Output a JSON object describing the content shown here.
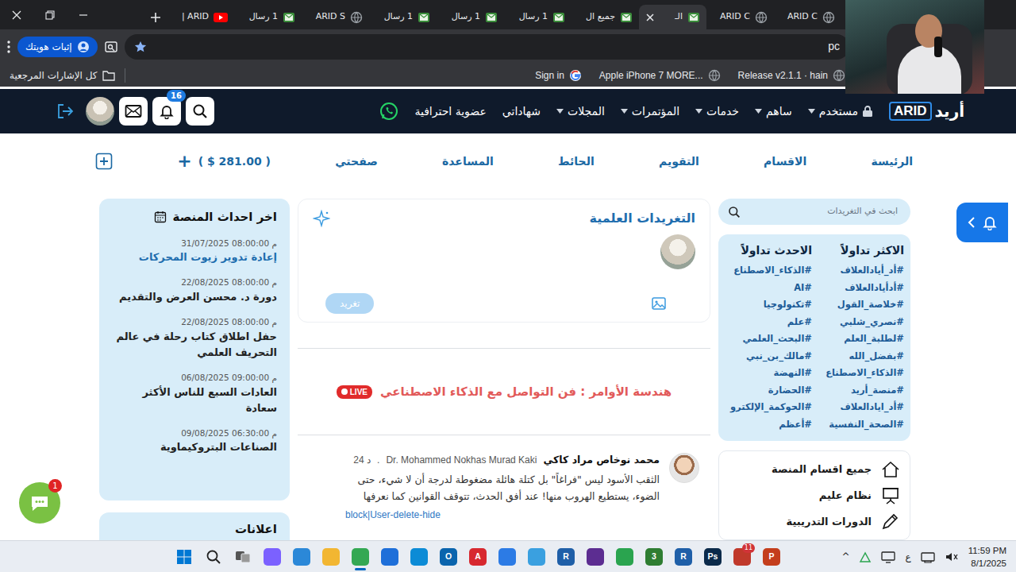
{
  "browser": {
    "tabs": [
      {
        "label": "ARID C",
        "kind": "globe",
        "selected": false
      },
      {
        "label": "ARID C",
        "kind": "globe",
        "selected": false
      },
      {
        "label": "الـ",
        "kind": "mail",
        "selected": true
      },
      {
        "label": "جميع ال",
        "kind": "mail",
        "selected": false
      },
      {
        "label": "1 رسال",
        "kind": "mail",
        "selected": false
      },
      {
        "label": "1 رسال",
        "kind": "mail",
        "selected": false
      },
      {
        "label": "1 رسال",
        "kind": "mail",
        "selected": false
      },
      {
        "label": "ARID S",
        "kind": "globe",
        "selected": false
      },
      {
        "label": "1 رسال",
        "kind": "mail",
        "selected": false
      },
      {
        "label": "ARID |",
        "kind": "youtube",
        "selected": false
      }
    ],
    "address": {
      "text": "pc",
      "bookmarked": true
    },
    "profile_button": "إثبات هويتك",
    "bookmarks": [
      {
        "label": "Release v2.1.1 · hain",
        "kind": "globe"
      },
      {
        "label": "Apple iPhone 7 MORE...",
        "kind": "globe"
      },
      {
        "label": "Sign in",
        "kind": "google"
      }
    ],
    "all_bookmarks": "كل الإشارات المرجعية"
  },
  "site": {
    "logo": {
      "latin": "ARID",
      "arabic": "أريد"
    },
    "nav": [
      {
        "label": "مستخدم",
        "dropdown": true,
        "locked": true
      },
      {
        "label": "ساهم",
        "dropdown": true,
        "locked": false
      },
      {
        "label": "خدمات",
        "dropdown": true,
        "locked": false
      },
      {
        "label": "المؤتمرات",
        "dropdown": true,
        "locked": false
      },
      {
        "label": "المجلات",
        "dropdown": true,
        "locked": false
      },
      {
        "label": "شهاداتي",
        "dropdown": false,
        "locked": false
      },
      {
        "label": "عضوية احترافية",
        "dropdown": false,
        "locked": false
      }
    ],
    "notification_count": "16",
    "subnav": [
      "الرئيسة",
      "الاقسام",
      "التقويم",
      "الحائط",
      "المساعدة",
      "صفحتي"
    ],
    "balance": {
      "amount": "( $ 281.00 )",
      "add": "+"
    },
    "tweet_search": {
      "placeholder": "ابحث في التغريدات"
    },
    "trending": {
      "most": {
        "title": "الاكثر تداولاً",
        "tags": [
          "#أد_أيادالعلاف",
          "#أدأيادالعلاف",
          "#خلاصة_القول",
          "#نصري_شلبي",
          "#لطلبة_العلم",
          "#بفضل_الله",
          "#الذكاء_الاصطناع",
          "#منصة_أريد",
          "#أد_ايادالعلاف",
          "#الصحة_النفسية"
        ]
      },
      "latest": {
        "title": "الاحدث تداولاً",
        "tags": [
          "#الذكاء_الاصطناع",
          "#AI",
          "#تكنولوجيا",
          "#علم",
          "#البحث_العلمي",
          "#مالك_بن_نبي",
          "#النهضة",
          "#الحضارة",
          "#الحوكمة_الإلكترو",
          "#أعظم"
        ]
      }
    },
    "menu": [
      {
        "label": "جميع اقسام المنصة",
        "kind": "home"
      },
      {
        "label": "نظام عليم",
        "kind": "board"
      },
      {
        "label": "الدورات التدريبية",
        "kind": "pen"
      }
    ],
    "compose": {
      "title": "التغريدات العلمية",
      "button": "تغريد",
      "button_disabled": true
    },
    "live": {
      "title": "هندسة الأوامر : فن التواصل مع الذكاء الاصطناعي",
      "badge": "LIVE"
    },
    "post": {
      "author": "محمد نوخاص مراد كاكي",
      "author_en": "Dr. Mohammed Nokhas Murad Kaki",
      "separator": ".",
      "time": "24 د",
      "text": "الثقب الأسود ليس \"فراغاً\" بل كتلة هائلة مضغوطة لدرجة أن لا شيء، حتى الضوء، يستطيع الهروب منها! عند أفق الحدث، تتوقف القوانين كما نعرفها",
      "actions": "block|User-delete-hide"
    },
    "events": {
      "title": "اخر احداث المنصة",
      "items": [
        {
          "date": "31/07/2025 08:00:00 م",
          "title": "إعادة تدوير زيوت المحركات",
          "highlighted": true
        },
        {
          "date": "22/08/2025 08:00:00 م",
          "title": "دورة د. محسن العرض والتقديم",
          "highlighted": false
        },
        {
          "date": "22/08/2025 08:00:00 م",
          "title": "حفل اطلاق كتاب رحلة في عالم التحريف العلمي",
          "highlighted": false
        },
        {
          "date": "06/08/2025 09:00:00 م",
          "title": "العادات السبع للناس الأكثر سعادة",
          "highlighted": false
        },
        {
          "date": "09/08/2025 06:30:00 م",
          "title": "الصناعات البتروكيماوية",
          "highlighted": false
        }
      ]
    },
    "ads": {
      "title": "اعلانات"
    },
    "chat": {
      "badge": "1"
    }
  },
  "taskbar": {
    "apps": [
      {
        "color": "#7b61ff",
        "selected": false
      },
      {
        "color": "#2b88d8",
        "selected": false
      },
      {
        "color": "#f2b632",
        "selected": false
      },
      {
        "color": "#34a853",
        "selected": true
      },
      {
        "color": "#1e6fd9",
        "selected": false
      },
      {
        "color": "#0c8bd6",
        "selected": false
      },
      {
        "glyph": "O",
        "color": "#0a64ad",
        "selected": false
      },
      {
        "glyph": "A",
        "color": "#d7282f",
        "selected": false
      },
      {
        "color": "#2c7be5",
        "selected": false
      },
      {
        "color": "#3aa0e0",
        "selected": false
      },
      {
        "glyph": "R",
        "color": "#1f5fa8",
        "selected": false
      },
      {
        "color": "#5c2d91",
        "selected": false
      },
      {
        "color": "#2aa44f",
        "selected": false
      },
      {
        "glyph": "3",
        "color": "#2e7d32",
        "selected": false
      },
      {
        "glyph": "R",
        "color": "#1f5fa8",
        "selected": false
      },
      {
        "glyph": "Ps",
        "color": "#0b2a4a",
        "selected": false
      },
      {
        "color": "#c0392b",
        "badge": "11",
        "selected": false
      },
      {
        "glyph": "P",
        "color": "#c43e1c",
        "selected": false
      }
    ],
    "tray": {
      "overflow": "^",
      "language": "ع",
      "time": "11:59 PM",
      "date": "8/1/2025"
    }
  }
}
